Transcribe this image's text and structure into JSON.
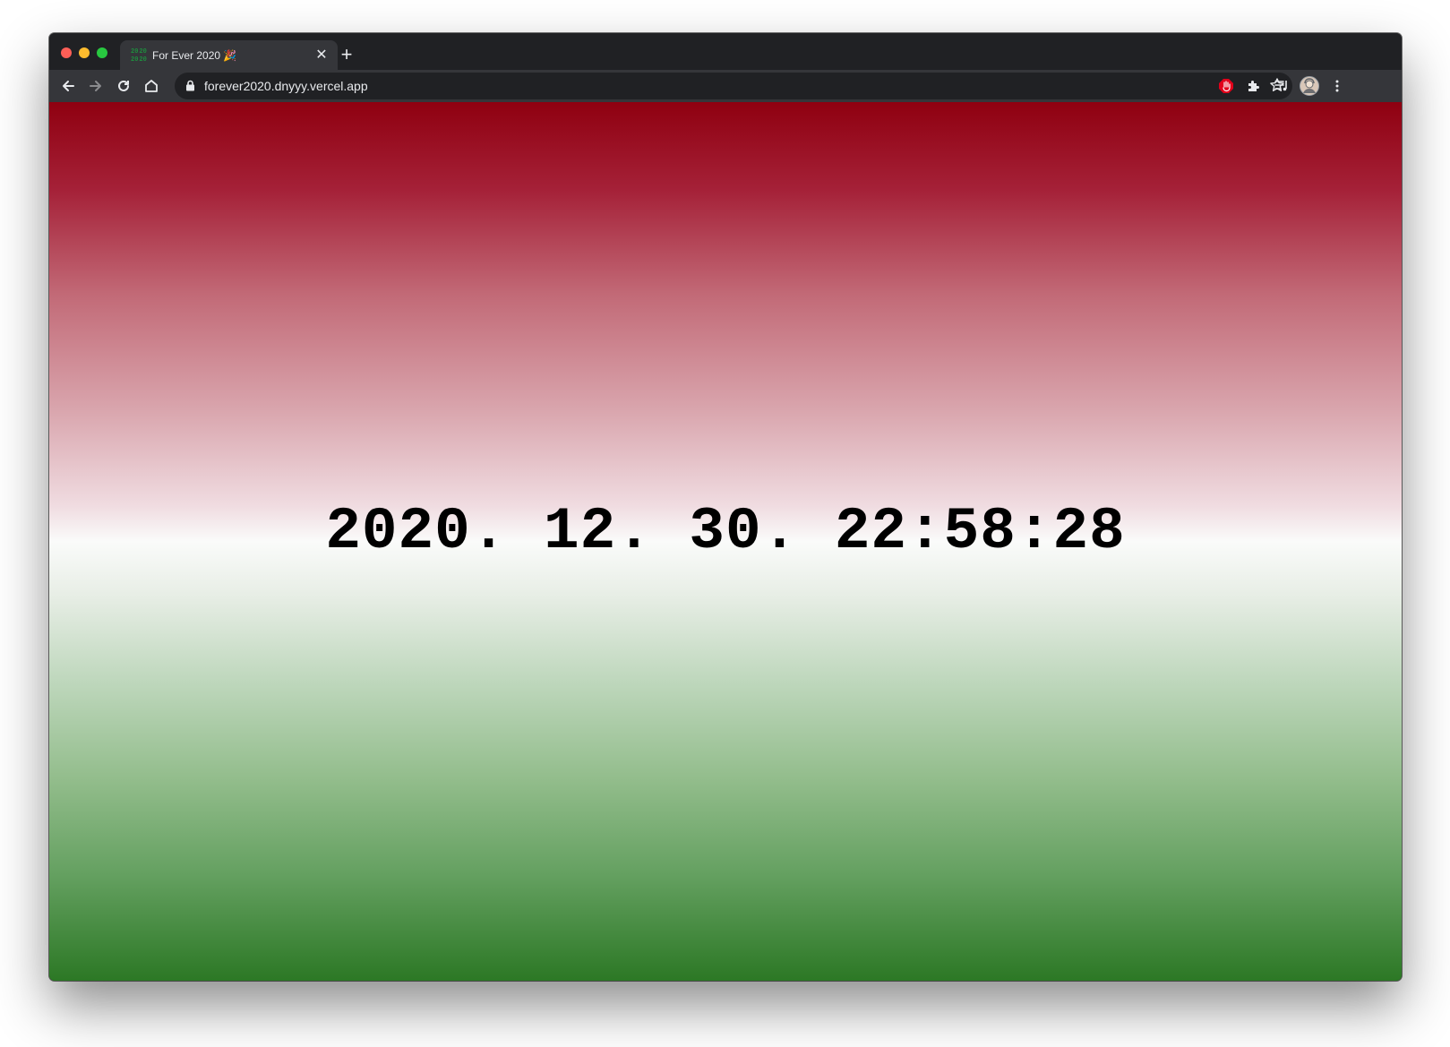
{
  "browser": {
    "tab": {
      "favicon": [
        "20",
        "20",
        "20",
        "20"
      ],
      "title": "For Ever 2020 🎉",
      "close_glyph": "✕"
    },
    "new_tab_glyph": "+",
    "address_bar": {
      "url": "forever2020.dnyyy.vercel.app"
    },
    "icons": [
      "back-icon",
      "forward-icon",
      "reload-icon",
      "home-icon",
      "lock-icon",
      "star-icon",
      "adblock-extension-icon",
      "extensions-icon",
      "media-control-icon",
      "profile-avatar",
      "menu-icon"
    ]
  },
  "page": {
    "clock_text": "2020. 12. 30. 22:58:28",
    "colors": {
      "top": "#8f0010",
      "middle": "#fafbfa",
      "bottom": "#2c7825"
    }
  }
}
